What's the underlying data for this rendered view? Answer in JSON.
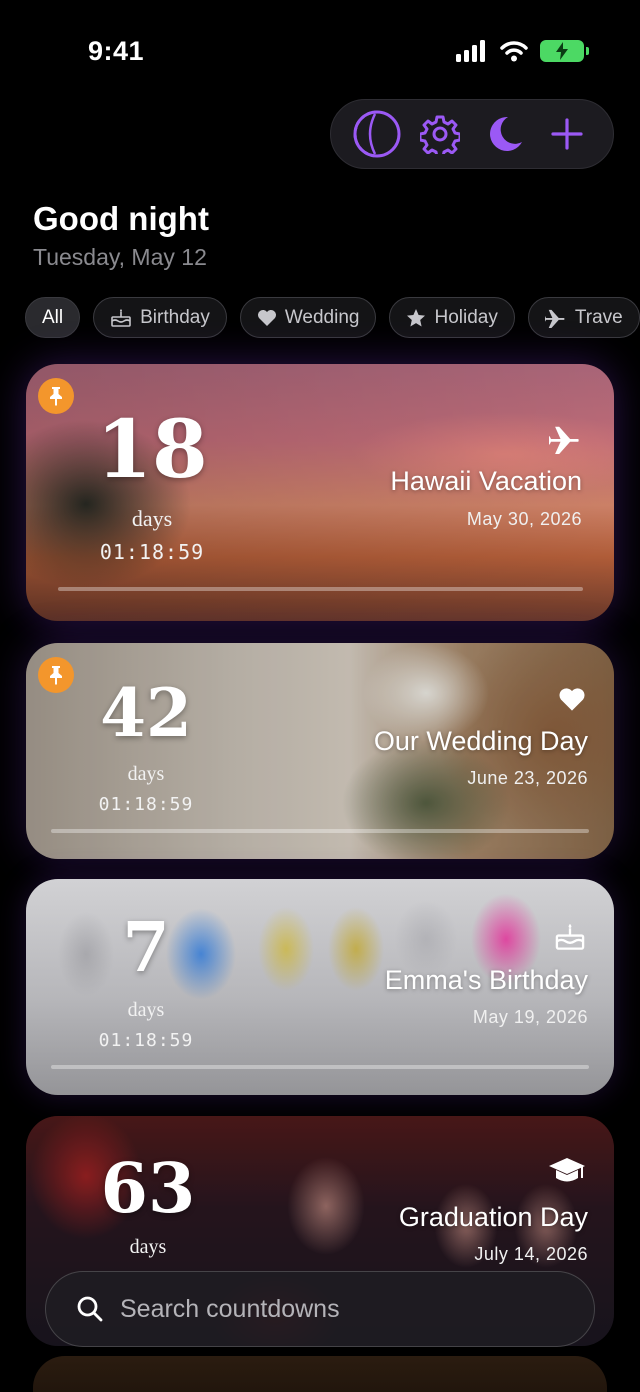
{
  "status_bar": {
    "time": "9:41"
  },
  "header": {
    "greeting": "Good night",
    "date": "Tuesday, May 12"
  },
  "toolbar": {
    "icons": [
      "circle-half-icon",
      "gear-icon",
      "moon-icon",
      "plus-icon"
    ]
  },
  "filters": [
    {
      "label": "All",
      "icon": ""
    },
    {
      "label": "Birthday",
      "icon": "cake-icon"
    },
    {
      "label": "Wedding",
      "icon": "heart-icon"
    },
    {
      "label": "Holiday",
      "icon": "star-icon"
    },
    {
      "label": "Trave",
      "icon": "plane-icon"
    }
  ],
  "countdowns": [
    {
      "days": "18",
      "days_label": "days",
      "timer": "01:18:59",
      "title": "Hawaii Vacation",
      "date": "May 30, 2026",
      "icon": "plane-icon",
      "pinned": true,
      "progress": 0
    },
    {
      "days": "42",
      "days_label": "days",
      "timer": "01:18:59",
      "title": "Our Wedding Day",
      "date": "June 23, 2026",
      "icon": "heart-icon",
      "pinned": true,
      "progress": 0
    },
    {
      "days": "7",
      "days_label": "days",
      "timer": "01:18:59",
      "title": "Emma's Birthday",
      "date": "May 19, 2026",
      "icon": "cake-icon",
      "pinned": false,
      "progress": 0
    },
    {
      "days": "63",
      "days_label": "days",
      "title": "Graduation Day",
      "date": "July 14, 2026",
      "icon": "graduation-cap-icon",
      "pinned": false
    }
  ],
  "search": {
    "placeholder": "Search countdowns"
  },
  "colors": {
    "accent": "#9b59f5",
    "pin": "#f3962c",
    "battery": "#4cd964"
  }
}
